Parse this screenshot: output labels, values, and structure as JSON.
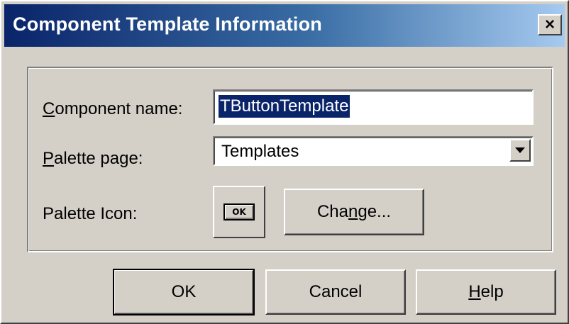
{
  "window": {
    "title": "Component Template Information",
    "close_symbol": "×"
  },
  "form": {
    "component_name": {
      "label_mnemonic": "C",
      "label_rest": "omponent name:",
      "value": "TButtonTemplate"
    },
    "palette_page": {
      "label_mnemonic": "P",
      "label_rest": "alette page:",
      "value": "Templates"
    },
    "palette_icon": {
      "label": "Palette Icon:",
      "preview_text": "OK"
    },
    "change_button": {
      "pre": "Cha",
      "mnemonic": "n",
      "post": "ge..."
    }
  },
  "buttons": {
    "ok": "OK",
    "cancel": "Cancel",
    "help_mnemonic": "H",
    "help_rest": "elp"
  },
  "icons": {
    "dropdown": "chevron-down-icon",
    "close": "close-icon",
    "preview": "ok-button-preview-icon"
  }
}
